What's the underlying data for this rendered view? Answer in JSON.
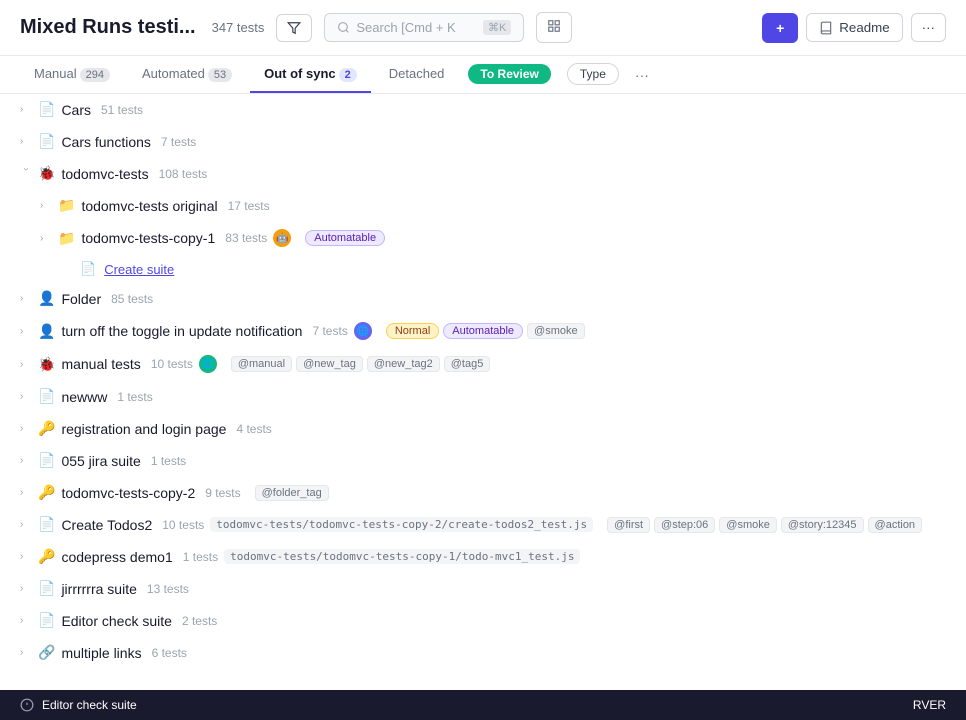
{
  "header": {
    "title": "Mixed Runs testi...",
    "count": "347 tests",
    "search_placeholder": "Search [Cmd + K",
    "add_label": "+",
    "readme_label": "Readme",
    "more_label": "···"
  },
  "tabs": [
    {
      "id": "manual",
      "label": "Manual",
      "count": "294",
      "active": false
    },
    {
      "id": "automated",
      "label": "Automated",
      "count": "53",
      "active": false
    },
    {
      "id": "out-of-sync",
      "label": "Out of sync",
      "count": "2",
      "active": true
    },
    {
      "id": "detached",
      "label": "Detached",
      "count": "",
      "active": false
    },
    {
      "id": "to-review",
      "label": "To Review",
      "pill": true,
      "active": false
    },
    {
      "id": "type",
      "label": "Type",
      "outline": true,
      "active": false
    }
  ],
  "items": [
    {
      "id": 1,
      "indent": 0,
      "icon": "📄",
      "name": "Cars",
      "count": "51 tests",
      "tags": [],
      "open": false,
      "path": ""
    },
    {
      "id": 2,
      "indent": 0,
      "icon": "📄",
      "name": "Cars functions",
      "count": "7 tests",
      "tags": [],
      "open": false,
      "path": ""
    },
    {
      "id": 3,
      "indent": 0,
      "icon": "🐞",
      "name": "todomvc-tests",
      "count": "108 tests",
      "tags": [],
      "open": true,
      "path": ""
    },
    {
      "id": 4,
      "indent": 1,
      "icon": "📁",
      "name": "todomvc-tests original",
      "count": "17 tests",
      "tags": [],
      "open": false,
      "path": ""
    },
    {
      "id": 5,
      "indent": 1,
      "icon": "📁",
      "name": "todomvc-tests-copy-1",
      "count": "83 tests",
      "tags": [
        "Automatable"
      ],
      "open": false,
      "path": "",
      "hasAvatar": true
    },
    {
      "id": 6,
      "indent": 2,
      "icon": "📄",
      "name": "Create suite",
      "count": "",
      "tags": [],
      "isLink": true,
      "open": false,
      "path": ""
    },
    {
      "id": 7,
      "indent": 0,
      "icon": "👤",
      "name": "Folder",
      "count": "85 tests",
      "tags": [],
      "open": false,
      "path": ""
    },
    {
      "id": 8,
      "indent": 0,
      "icon": "👤",
      "name": "turn off the toggle in update notification",
      "count": "7 tests",
      "tags": [
        "Normal",
        "Automatable",
        "@smoke"
      ],
      "open": false,
      "path": "",
      "hasAvatar2": true
    },
    {
      "id": 9,
      "indent": 0,
      "icon": "🐞",
      "name": "manual tests",
      "count": "10 tests",
      "tags": [
        "@manual",
        "@new_tag",
        "@new_tag2",
        "@tag5"
      ],
      "open": false,
      "path": "",
      "hasAvatar3": true
    },
    {
      "id": 10,
      "indent": 0,
      "icon": "📄",
      "name": "newww",
      "count": "1 tests",
      "tags": [],
      "open": false,
      "path": ""
    },
    {
      "id": 11,
      "indent": 0,
      "icon": "🔑",
      "name": "registration and login page",
      "count": "4 tests",
      "tags": [],
      "open": false,
      "path": ""
    },
    {
      "id": 12,
      "indent": 0,
      "icon": "📄",
      "name": "055 jira suite",
      "count": "1 tests",
      "tags": [],
      "open": false,
      "path": ""
    },
    {
      "id": 13,
      "indent": 0,
      "icon": "🔑",
      "name": "todomvc-tests-copy-2",
      "count": "9 tests",
      "tags": [
        "@folder_tag"
      ],
      "open": false,
      "path": ""
    },
    {
      "id": 14,
      "indent": 0,
      "icon": "📄",
      "name": "Create Todos2",
      "count": "10 tests",
      "tags": [
        "@first",
        "@step:06",
        "@smoke",
        "@story:12345",
        "@action"
      ],
      "open": false,
      "path": "todomvc-tests/todomvc-tests-copy-2/create-todos2_test.js"
    },
    {
      "id": 15,
      "indent": 0,
      "icon": "🔑",
      "name": "codepress demo1",
      "count": "1 tests",
      "tags": [],
      "open": false,
      "path": "todomvc-tests/todomvc-tests-copy-1/todo-mvc1_test.js"
    },
    {
      "id": 16,
      "indent": 0,
      "icon": "📄",
      "name": "jirrrrrra suite",
      "count": "13 tests",
      "tags": [],
      "open": false,
      "path": ""
    },
    {
      "id": 17,
      "indent": 0,
      "icon": "📄",
      "name": "Editor check suite",
      "count": "2 tests",
      "tags": [],
      "open": false,
      "path": ""
    },
    {
      "id": 18,
      "indent": 0,
      "icon": "🔗",
      "name": "multiple links",
      "count": "6 tests",
      "tags": [],
      "open": false,
      "path": ""
    }
  ],
  "footer": {
    "label": "Editor check suite",
    "right_text": "RVER"
  }
}
